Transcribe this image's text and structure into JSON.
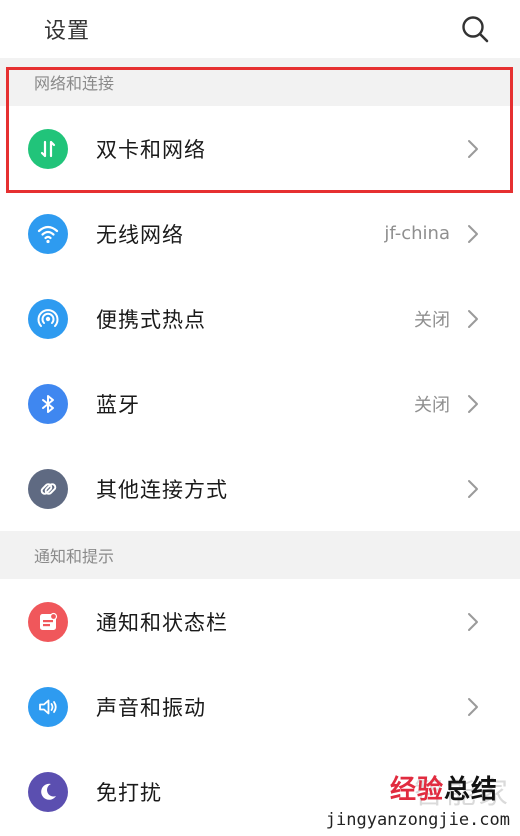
{
  "header": {
    "title": "设置"
  },
  "sections": [
    {
      "title": "网络和连接",
      "items": [
        {
          "label": "双卡和网络",
          "value": "",
          "icon": "sim-network-icon",
          "color": "#21c47a"
        },
        {
          "label": "无线网络",
          "value": "jf-china",
          "icon": "wifi-icon",
          "color": "#2e9bf0"
        },
        {
          "label": "便携式热点",
          "value": "关闭",
          "icon": "hotspot-icon",
          "color": "#2e9bf0"
        },
        {
          "label": "蓝牙",
          "value": "关闭",
          "icon": "bluetooth-icon",
          "color": "#3f87f0"
        },
        {
          "label": "其他连接方式",
          "value": "",
          "icon": "link-icon",
          "color": "#5f6a82"
        }
      ]
    },
    {
      "title": "通知和提示",
      "items": [
        {
          "label": "通知和状态栏",
          "value": "",
          "icon": "notification-icon",
          "color": "#f0575b"
        },
        {
          "label": "声音和振动",
          "value": "",
          "icon": "sound-icon",
          "color": "#2e9bf0"
        },
        {
          "label": "免打扰",
          "value": "",
          "icon": "moon-icon",
          "color": "#5b4fb0"
        }
      ]
    }
  ],
  "watermark": {
    "faint": "智能家",
    "brand_red": "经验",
    "brand_black": "总结",
    "url": "jingyanzongjie.com"
  },
  "highlight_color": "#e63031"
}
